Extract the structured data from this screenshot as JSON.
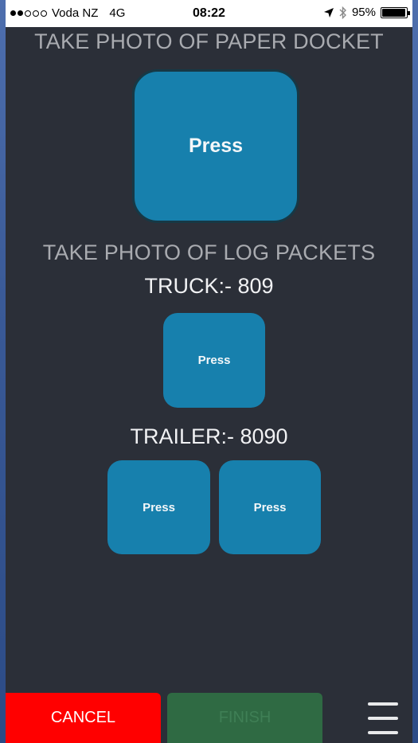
{
  "status_bar": {
    "carrier": "Voda NZ",
    "network": "4G",
    "time": "08:22",
    "battery": "95%",
    "battery_level": 0.95,
    "signal_bars_filled": 2,
    "signal_bars_total": 5
  },
  "docket_section": {
    "heading": "TAKE PHOTO OF PAPER DOCKET",
    "button_label": "Press"
  },
  "packets_section": {
    "heading": "TAKE PHOTO OF LOG PACKETS",
    "truck_label": "TRUCK:- 809",
    "truck_button_label": "Press",
    "trailer_label": "TRAILER:- 8090",
    "trailer_button_1_label": "Press",
    "trailer_button_2_label": "Press"
  },
  "footer": {
    "cancel_label": "CANCEL",
    "finish_label": "FINISH"
  },
  "icons": {
    "location": "location-arrow-icon",
    "bluetooth": "bluetooth-icon",
    "battery": "battery-icon",
    "menu": "hamburger-menu-icon"
  },
  "colors": {
    "background": "#2b2f38",
    "button": "#1780ad",
    "cancel": "#ff0000",
    "finish": "#2f6a43",
    "heading": "#a9abb0"
  }
}
